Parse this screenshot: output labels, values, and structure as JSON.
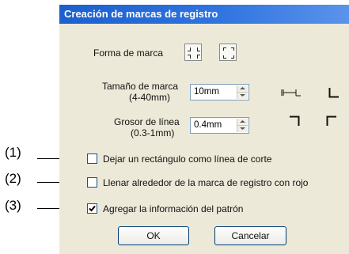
{
  "dialog": {
    "title": "Creación de marcas de registro",
    "shape_label": "Forma de marca",
    "shape_options": [
      "cross-corner-mark-icon",
      "bracket-corner-mark-icon"
    ],
    "size_label_line1": "Tamaño de marca",
    "size_label_line2": "(4-40mm)",
    "size_value": "10mm",
    "line_label_line1": "Grosor de línea",
    "line_label_line2": "(0.3-1mm)",
    "line_value": "0.4mm",
    "checkboxes": [
      {
        "label": "Dejar un rectángulo como línea de corte",
        "checked": false
      },
      {
        "label": "Llenar alrededor de la marca de registro con rojo",
        "checked": false
      },
      {
        "label": "Agregar la información del patrón",
        "checked": true
      }
    ],
    "ok_label": "OK",
    "cancel_label": "Cancelar"
  },
  "callouts": [
    "(1)",
    "(2)",
    "(3)"
  ],
  "colors": {
    "titlebar": "#2f74e0",
    "dialog_bg": "#ece9d8",
    "button_border": "#003c74"
  }
}
